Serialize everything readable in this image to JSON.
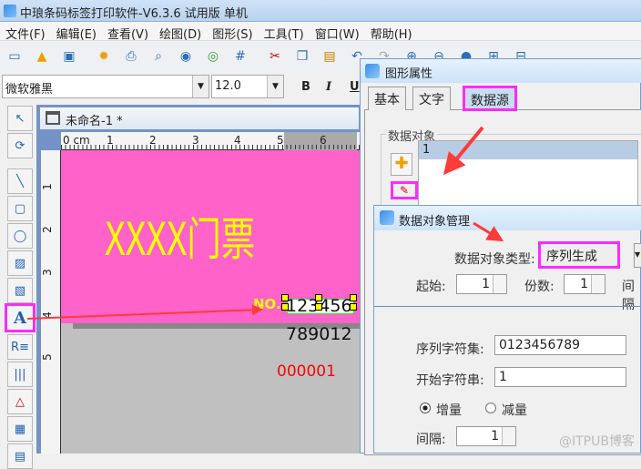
{
  "window": {
    "title": "中琅条码标签打印软件-V6.3.6 试用版 单机"
  },
  "menu": [
    "文件(F)",
    "编辑(E)",
    "查看(V)",
    "绘图(D)",
    "图形(S)",
    "工具(T)",
    "窗口(W)",
    "帮助(H)"
  ],
  "toolbar": [
    "new-icon",
    "open-icon",
    "save-icon",
    "settings-icon",
    "print-icon",
    "print-preview-icon",
    "database-icon",
    "database-connect-icon",
    "grid-icon",
    "cut-icon",
    "copy-icon",
    "paste-icon",
    "undo-icon",
    "redo-icon",
    "zoom-in-icon",
    "zoom-out-icon",
    "zoom-fit-icon",
    "fit-width-icon",
    "fit-height-icon"
  ],
  "fontbar": {
    "font": "微软雅黑",
    "size": "12.0",
    "bold": "B",
    "italic": "I",
    "underline": "U"
  },
  "document": {
    "tab": "未命名-1 *",
    "ruler_h": [
      "0 cm",
      "1",
      "2",
      "3",
      "4",
      "5",
      "6"
    ],
    "ruler_v": [
      "1",
      "2",
      "3",
      "4",
      "5"
    ],
    "label_title": "XXXX门票",
    "no_label": "NO.",
    "serial1": "123456",
    "serial2": "789012",
    "serial3": "000001"
  },
  "props_dialog": {
    "title": "图形属性",
    "tabs": [
      "基本",
      "文字",
      "数据源"
    ],
    "active_tab": "数据源",
    "group": "数据对象",
    "list": [
      "1"
    ]
  },
  "data_dialog": {
    "title": "数据对象管理",
    "type_label": "数据对象类型:",
    "type_value": "序列生成",
    "start_label": "起始:",
    "start_value": "1",
    "copies_label": "份数:",
    "copies_value": "1",
    "interval_top_label": "间隔",
    "charset_label": "序列字符集:",
    "charset_value": "0123456789",
    "startstr_label": "开始字符串:",
    "startstr_value": "1",
    "inc_label": "增量",
    "dec_label": "减量",
    "interval_label": "间隔:",
    "interval_value": "1"
  },
  "watermark": "@ITPUB博客",
  "colors": {
    "label_bg": "#ff62c8",
    "title_text": "#ffff00",
    "highlight": "#ff2bff",
    "arrow": "#ff3b3b"
  }
}
